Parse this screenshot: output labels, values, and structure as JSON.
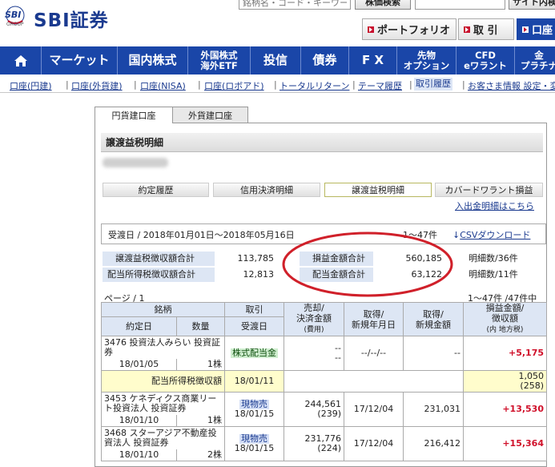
{
  "header": {
    "logo_mark": "SBI",
    "logo_group": "GROUP",
    "logo_text": "SBI証券",
    "search_placeholder": "銘柄名・コード・キーワード",
    "search_button": "株価検索",
    "site_search_button": "サイト内検",
    "buttons": [
      "ポートフォリオ",
      "取 引",
      "口座"
    ]
  },
  "nav": {
    "home_icon": "home-icon",
    "items": [
      "マーケット",
      "国内株式",
      "外国株式\n海外ETF",
      "投信",
      "債券",
      "F X",
      "先物\nオプション",
      "CFD\neワラント",
      "金\nプラチナ"
    ]
  },
  "subnav": {
    "items": [
      "口座(円建)",
      "口座(外貨建)",
      "口座(NISA)",
      "口座(ロボアド)",
      "トータルリターン",
      "テーマ履歴",
      "取引履歴",
      "お客さま情報 設定・変"
    ]
  },
  "tabs": [
    "円貨建口座",
    "外貨建口座"
  ],
  "section_title": "譲渡益税明細",
  "btabs": [
    "約定履歴",
    "信用決済明細",
    "譲渡益税明細",
    "カバードワラント損益"
  ],
  "link_deposit": "入出金明細はこちら",
  "summary": {
    "period": "受渡日 / 2018年01月01日〜2018年05月16日",
    "count": "1〜47件",
    "csv_link": "CSVダウンロード"
  },
  "totals": {
    "row1": {
      "label": "譲渡益税徴収額合計",
      "value": "113,785",
      "label2": "損益金額合計",
      "value2": "560,185",
      "detail": "明細数/36件"
    },
    "row2": {
      "label": "配当所得税徴収額合計",
      "value": "12,813",
      "label2": "配当金額合計",
      "value2": "63,122",
      "detail": "明細数/11件"
    }
  },
  "page_label": "ページ / 1",
  "page_count": "1〜47件 /47件中",
  "table": {
    "headers": {
      "meigara": "銘柄",
      "torihiki": "取引",
      "baikyaku": "売却/\n決済金額",
      "baikyaku_sub": "(費用)",
      "shutoku_date": "取得/\n新規年月日",
      "shutoku_amt": "取得/\n新規金額",
      "soneki": "損益金額/\n徴収額",
      "soneki_sub": "(内 地方税)",
      "yakujo": "約定日",
      "suryo": "数量",
      "ukewatashi": "受渡日"
    },
    "rows": [
      {
        "name": "3476 投資法人みらい 投資証券",
        "type": "株式配当金",
        "sell": "--",
        "sell_fee": "--",
        "acq_date": "--/--/--",
        "acq_amt": "--",
        "pl": "+5,175",
        "date": "18/01/05",
        "qty": "1株",
        "settle": "18/01/11"
      },
      {
        "tax_label": "配当所得税徴収額",
        "settle": "18/01/11",
        "tax": "1,050",
        "tax_local": "(258)"
      },
      {
        "name": "3453 ケネディクス商業リート投資法人 投資証券",
        "type": "現物売",
        "sell": "244,561",
        "sell_fee": "(239)",
        "acq_date": "17/12/04",
        "acq_amt": "231,031",
        "pl": "+13,530",
        "date": "18/01/10",
        "qty": "1株",
        "settle": "18/01/15"
      },
      {
        "name": "3468 スターアジア不動産投資法人 投資証券",
        "type": "現物売",
        "sell": "231,776",
        "sell_fee": "(224)",
        "acq_date": "17/12/04",
        "acq_amt": "216,412",
        "pl": "+15,364",
        "date": "18/01/10",
        "qty": "2株",
        "settle": "18/01/15"
      }
    ]
  },
  "colors": {
    "brand_blue": "#1a46a8",
    "accent_red": "#d0102a",
    "highlight_circle": "#d0202a"
  }
}
